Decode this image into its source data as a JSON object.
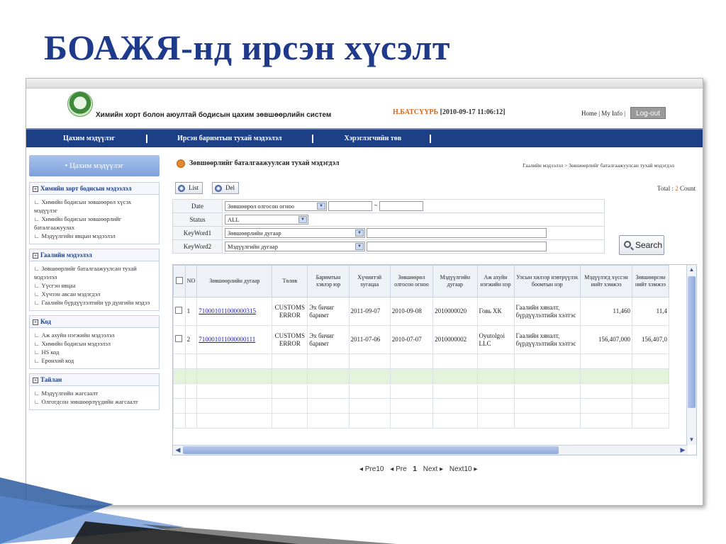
{
  "slide": {
    "title": "БОАЖЯ-нд ирсэн хүсэлт"
  },
  "header": {
    "system_name": "Химийн хорт болон аюултай бодисын цахим зөвшөөрлийн систем",
    "user_name": "Н.БАТСҮҮРЬ",
    "timestamp": "[2010-09-17 11:06:12]",
    "links": "Home | My Info |",
    "logout": "Log-out"
  },
  "nav": {
    "items": [
      {
        "label": "Цахим мэдүүлэг"
      },
      {
        "label": "Ирсэн баримтын тухай мэдээлэл"
      },
      {
        "label": "Хэрэглэгчийн төв"
      }
    ]
  },
  "sidebar": {
    "title": "• Цахим мэдүүлэг",
    "groups": [
      {
        "title": "Химийн хорт бодисын мэдээлэл",
        "items": [
          "Химийн бодисын зөвшөөрөл хүсэх мэдүүлэг",
          "Химийн бодисын зөвшөөрлийг баталгаажуулах",
          "Мэдүүлгийн явцын мэдээлэл"
        ]
      },
      {
        "title": "Гаалийн мэдээлэл",
        "items": [
          "Зөвшөөрлийг баталгаажуулсан тухай мэдээлэл",
          "Үүсгэн явцаа",
          "Хүчээн авсан мэдэгдэл",
          "Гаалийн бүрдүүлэлтийн үр дүнгийн мэдээ"
        ]
      },
      {
        "title": "Код",
        "items": [
          "Аж ахуйн нэгжийн мэдээлэл",
          "Химийн бодисын мэдээлэл",
          "HS код",
          "Ерөнхий код"
        ]
      },
      {
        "title": "Тайлан",
        "items": [
          "Мэдүүлгийн жагсаалт",
          "Олгогдсон зөвшөөрлүүдийн жагсаалт"
        ]
      }
    ]
  },
  "main": {
    "page_title": "Зөвшөөрлийг баталгаажуулсан тухай мэдэгдэл",
    "breadcrumb": "Гаалийн мэдээлэл > Зөвшөөрлийг баталгаажуулсан тухай мэдэгдэл",
    "btn_list": "List",
    "btn_del": "Del",
    "total_label": "Total : ",
    "total_count": "2",
    "total_suffix": " Count",
    "form": {
      "date_label": "Date",
      "date_select": "Зөвшөөрөл олгосон огноо",
      "date_sep": "~",
      "status_label": "Status",
      "status_select": "ALL",
      "kw1_label": "KeyWord1",
      "kw1_select": "Зөвшөөрлийн дугаар",
      "kw2_label": "KeyWord2",
      "kw2_select": "Мэдүүлгийн дугаар"
    },
    "search_label": "Search",
    "columns": [
      "NO",
      "Зөвшөөрлийн дугаар",
      "Төлөв",
      "Баримтын хэвлэр юр",
      "Хүчинтэй хугацаа",
      "Зөвшөөрөл олгосон огноо",
      "Мэдүүлгийн дугаар",
      "Аж ахуйн нэгжийн нэр",
      "Улсын хилээр нэвтрүүлэх боомтын нэр",
      "Мэдүүлэгд хүссэн нийт хэмжээ",
      "Зөвшөөрсөн нийт хэмжээ"
    ],
    "rows": [
      {
        "no": "1",
        "permit": "710001011000000315",
        "status": "CUSTOMS ERROR",
        "doc": "Эх бичиг баримт",
        "valid": "2011-09-07",
        "issued": "2010-09-08",
        "decl": "2010000020",
        "company": "Говь ХК",
        "port": "Гаалийн хяналт, бүрдүүлэлтийн хэлтэс",
        "requested": "11,460",
        "approved": "11,4"
      },
      {
        "no": "2",
        "permit": "710001011000000111",
        "status": "CUSTOMS ERROR",
        "doc": "Эх бичиг баримт",
        "valid": "2011-07-06",
        "issued": "2010-07-07",
        "decl": "2010000002",
        "company": "Oyutolgoi LLC",
        "port": "Гаалийн хяналт, бүрдүүлэлтийн хэлтэс",
        "requested": "156,407,000",
        "approved": "156,407,0"
      }
    ],
    "pager": {
      "prev10": "◂ Pre10",
      "prev": "◂ Pre",
      "page": "1",
      "next": "Next ▸",
      "next10": "Next10 ▸"
    }
  },
  "colors": {
    "nav": "#1c3f86",
    "title": "#1f3a8a",
    "accent": "#d9661c"
  }
}
